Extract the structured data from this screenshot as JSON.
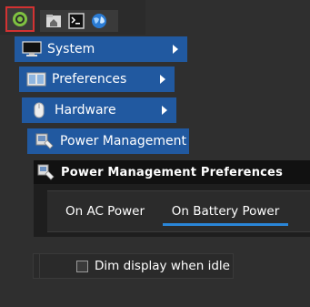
{
  "panel": {
    "start_icon": "start-menu-icon",
    "launchers": [
      "home-folder-icon",
      "terminal-icon",
      "web-browser-icon"
    ]
  },
  "menus": [
    {
      "label": "System",
      "icon": "monitor-icon",
      "has_submenu": true
    },
    {
      "label": "Preferences",
      "icon": "preferences-icon",
      "has_submenu": true
    },
    {
      "label": "Hardware",
      "icon": "mouse-icon",
      "has_submenu": true
    },
    {
      "label": "Power Management",
      "icon": "power-management-icon",
      "has_submenu": false
    }
  ],
  "dialog": {
    "title": "Power Management Preferences",
    "tabs": [
      {
        "label": "On AC Power",
        "selected": false
      },
      {
        "label": "On Battery Power",
        "selected": true
      }
    ],
    "dim_option": {
      "label": "Dim display when idle",
      "checked": false
    }
  },
  "colors": {
    "menu_bg": "#2159a0",
    "background": "#2f2f2f",
    "tab_indicator": "#2a86d8",
    "start_highlight": "#d23232",
    "start_icon": "#7fc241"
  }
}
